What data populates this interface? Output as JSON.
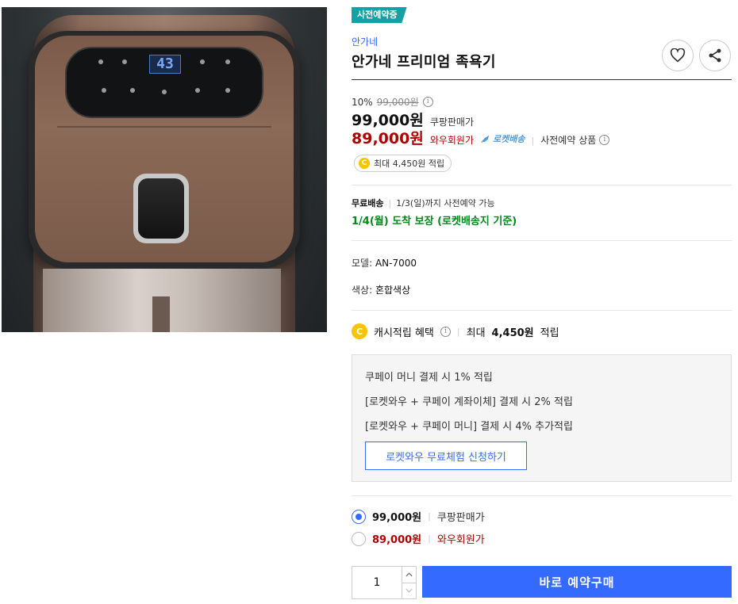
{
  "product": {
    "preorder_badge": "사전예약중",
    "brand": "안가네",
    "title": "안가네 프리미엄 족욕기",
    "image_alt": "안가네 프리미엄 족욕기 product photo",
    "display_digits": "43"
  },
  "pricing": {
    "discount_rate": "10%",
    "original_price": "99,000원",
    "info_icon": "i",
    "coupang_price": "99,000원",
    "coupang_label": "쿠팡판매가",
    "wow_price": "89,000원",
    "wow_label": "와우회원가",
    "rocket_label": "로켓배송",
    "separator": "|",
    "preorder_note": "사전예약 상품"
  },
  "cash_pill": {
    "coin": "C",
    "text": "최대 4,450원 적립"
  },
  "delivery": {
    "label": "무료배송",
    "separator": "|",
    "note": "1/3(일)까지 사전예약 가능",
    "arrival": "1/4(월) 도착 보장 (로켓배송지 기준)"
  },
  "options": {
    "model": {
      "label": "모델:",
      "value": "AN-7000"
    },
    "color": {
      "label": "색상:",
      "value": "혼합색상"
    }
  },
  "cash_benefit": {
    "coin": "C",
    "label": "캐시적립 혜택",
    "separator": "|",
    "prefix": "최대",
    "amount": "4,450원",
    "suffix": "적립"
  },
  "coupay": {
    "lines": [
      "쿠페이 머니 결제 시 1% 적립",
      "[로켓와우 + 쿠페이 계좌이체] 결제 시 2% 적립",
      "[로켓와우 + 쿠페이 머니] 결제 시 4% 추가적립"
    ],
    "trial_button": "로켓와우 무료체험 신청하기"
  },
  "price_options": [
    {
      "price": "99,000원",
      "separator": "|",
      "label": "쿠팡판매가",
      "selected": true
    },
    {
      "price": "89,000원",
      "separator": "|",
      "label": "와우회원가",
      "selected": false
    }
  ],
  "purchase": {
    "quantity": "1",
    "buy_button": "바로 예약구매"
  },
  "icons": [
    "heart-icon",
    "share-icon",
    "info-icon",
    "coin-icon",
    "rocket-icon",
    "chevron-up-icon",
    "chevron-down-icon"
  ],
  "colors": {
    "accent": "#346aff",
    "wow_red": "#ae0000",
    "arrival_green": "#00891a",
    "badge_teal": "#12a1a4",
    "coin_yellow": "#f7c400"
  }
}
